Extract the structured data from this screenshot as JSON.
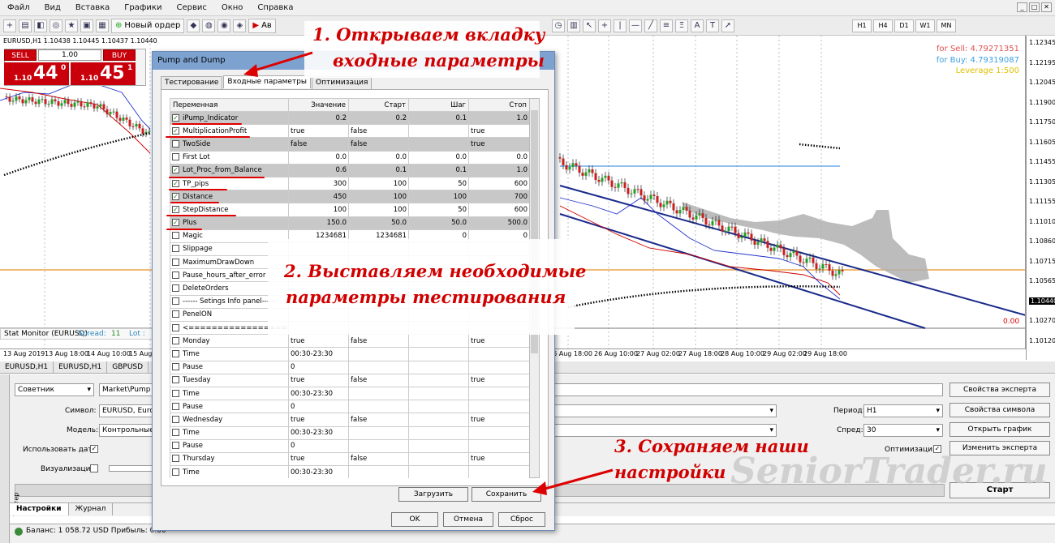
{
  "menu": [
    "Файл",
    "Вид",
    "Вставка",
    "Графики",
    "Сервис",
    "Окно",
    "Справка"
  ],
  "toolbar": {
    "new_order": "Новый ордер",
    "autotrade": "Ав",
    "timeframes": [
      "H1",
      "H4",
      "D1",
      "W1",
      "MN"
    ]
  },
  "chart": {
    "symbol_label": "EURUSD,H1  1.10438 1.10445 1.10437 1.10440",
    "sell_label": "SELL",
    "buy_label": "BUY",
    "lot": "1.00",
    "sell_small": "1.10",
    "sell_big": "44",
    "sell_sup": "0",
    "buy_small": "1.10",
    "buy_big": "45",
    "buy_sup": "1",
    "for_sell": "for Sell: 4.79271351",
    "for_buy": "for Buy: 4.79319087",
    "leverage": "Leverage 1:500",
    "price_axis": [
      "1.12345",
      "1.12195",
      "1.12045",
      "1.11900",
      "1.11750",
      "1.11605",
      "1.11455",
      "1.11305",
      "1.11155",
      "1.11010",
      "1.10860",
      "1.10715",
      "1.10565",
      "1.10440",
      "1.10270",
      "1.10120"
    ],
    "current_price": "1.10440",
    "zero_value": "0.00",
    "stat_monitor": "Stat Monitor (EURUSD)",
    "spread_label": "Spread:",
    "spread_value": "11",
    "lot_label": "Lot :",
    "time_axis": [
      "13 Aug 2019",
      "13 Aug 18:00",
      "14 Aug 10:00",
      "15 Aug",
      "26 Aug 18:00",
      "26 Aug 10:00",
      "27 Aug 02:00",
      "27 Aug 18:00",
      "28 Aug 10:00",
      "29 Aug 02:00",
      "29 Aug 18:00"
    ],
    "colors": {
      "line_blue": "#1f3aa0",
      "ichimoku_gray": "#a8a8a8",
      "candle_green": "#22a022",
      "candle_red": "#c82020",
      "accent_red": "#c9000b"
    }
  },
  "chart_tabs": [
    "EURUSD,H1",
    "EURUSD,H1",
    "GBPUSD"
  ],
  "tester": {
    "type": "Советник",
    "expert_path": "Market\\Pump and Dump",
    "symbol_label": "Символ:",
    "symbol_value": "EURUSD, Euro",
    "model_label": "Модель:",
    "model_value": "Контрольные т",
    "use_date_label": "Использовать дату",
    "visual_label": "Визуализация",
    "period_label": "Период:",
    "period_value": "H1",
    "spread_label": "Спред:",
    "spread_value": "30",
    "optimization_label": "Оптимизация",
    "btn_expert_props": "Свойства эксперта",
    "btn_symbol_props": "Свойства символа",
    "btn_open_chart": "Открыть график",
    "btn_change_expert": "Изменить эксперта",
    "btn_start": "Старт"
  },
  "bottom_tabs": [
    "Настройки",
    "Журнал"
  ],
  "side_label": "Тестер",
  "status": "Баланс: 1 058.72 USD  Прибыль: 0.00",
  "dialog": {
    "title": "Pump and Dump",
    "tabs": [
      "Тестирование",
      "Входные параметры",
      "Оптимизация"
    ],
    "headers": [
      "Переменная",
      "Значение",
      "Старт",
      "Шаг",
      "Стоп"
    ],
    "rows": [
      {
        "c": true,
        "n": "iPump_Indicator",
        "v": "0.2",
        "s": "0.2",
        "st": "0.1",
        "e": "1.0",
        "sel": true
      },
      {
        "c": true,
        "n": "MultiplicationProfit",
        "v": "true",
        "s": "false",
        "st": "",
        "e": "true",
        "sel": false
      },
      {
        "c": false,
        "n": "TwoSide",
        "v": "false",
        "s": "false",
        "st": "",
        "e": "true",
        "sel": true
      },
      {
        "c": false,
        "n": "First Lot",
        "v": "0.0",
        "s": "0.0",
        "st": "0.0",
        "e": "0.0",
        "sel": false
      },
      {
        "c": true,
        "n": "Lot_Proc_from_Balance",
        "v": "0.6",
        "s": "0.1",
        "st": "0.1",
        "e": "1.0",
        "sel": true
      },
      {
        "c": true,
        "n": "TP_pips",
        "v": "300",
        "s": "100",
        "st": "50",
        "e": "600",
        "sel": false
      },
      {
        "c": true,
        "n": "Distance",
        "v": "450",
        "s": "100",
        "st": "100",
        "e": "700",
        "sel": true
      },
      {
        "c": true,
        "n": "StepDistance",
        "v": "100",
        "s": "100",
        "st": "50",
        "e": "600",
        "sel": false
      },
      {
        "c": true,
        "n": "Plus",
        "v": "150.0",
        "s": "50.0",
        "st": "50.0",
        "e": "500.0",
        "sel": true
      },
      {
        "c": false,
        "n": "Magic",
        "v": "1234681",
        "s": "1234681",
        "st": "0",
        "e": "0",
        "sel": false
      },
      {
        "c": false,
        "n": "Slippage",
        "v": "",
        "s": "",
        "st": "",
        "e": "",
        "sel": false
      },
      {
        "c": false,
        "n": "MaximumDrawDown",
        "v": "",
        "s": "",
        "st": "",
        "e": "",
        "sel": false
      },
      {
        "c": false,
        "n": "Pause_hours_after_error",
        "v": "",
        "s": "",
        "st": "",
        "e": "",
        "sel": false
      },
      {
        "c": false,
        "n": "DeleteOrders",
        "v": "",
        "s": "",
        "st": "",
        "e": "",
        "sel": false
      },
      {
        "c": false,
        "n": "------ Setings Info panel------",
        "v": "",
        "s": "",
        "st": "",
        "e": "",
        "sel": false
      },
      {
        "c": false,
        "n": "PenelON",
        "v": "",
        "s": "",
        "st": "",
        "e": "",
        "sel": false
      },
      {
        "c": false,
        "n": "<==========================",
        "v": "",
        "s": "",
        "st": "",
        "e": "",
        "sel": false
      },
      {
        "c": false,
        "n": "Monday",
        "v": "true",
        "s": "false",
        "st": "",
        "e": "true",
        "sel": false
      },
      {
        "c": false,
        "n": "Time",
        "v": "00:30-23:30",
        "s": "",
        "st": "",
        "e": "",
        "sel": false
      },
      {
        "c": false,
        "n": "Pause",
        "v": "0",
        "s": "",
        "st": "",
        "e": "",
        "sel": false
      },
      {
        "c": false,
        "n": "Tuesday",
        "v": "true",
        "s": "false",
        "st": "",
        "e": "true",
        "sel": false
      },
      {
        "c": false,
        "n": "Time",
        "v": "00:30-23:30",
        "s": "",
        "st": "",
        "e": "",
        "sel": false
      },
      {
        "c": false,
        "n": "Pause",
        "v": "0",
        "s": "",
        "st": "",
        "e": "",
        "sel": false
      },
      {
        "c": false,
        "n": "Wednesday",
        "v": "true",
        "s": "false",
        "st": "",
        "e": "true",
        "sel": false
      },
      {
        "c": false,
        "n": "Time",
        "v": "00:30-23:30",
        "s": "",
        "st": "",
        "e": "",
        "sel": false
      },
      {
        "c": false,
        "n": "Pause",
        "v": "0",
        "s": "",
        "st": "",
        "e": "",
        "sel": false
      },
      {
        "c": false,
        "n": "Thursday",
        "v": "true",
        "s": "false",
        "st": "",
        "e": "true",
        "sel": false
      },
      {
        "c": false,
        "n": "Time",
        "v": "00:30-23:30",
        "s": "",
        "st": "",
        "e": "",
        "sel": false
      }
    ],
    "btn_load": "Загрузить",
    "btn_save": "Сохранить",
    "btn_ok": "OK",
    "btn_cancel": "Отмена",
    "btn_reset": "Сброс"
  },
  "annotations": {
    "step1_line1": "1. Открываем вкладку",
    "step1_line2": "входные параметры",
    "step2_line1": "2. Выставляем необходимые",
    "step2_line2": "параметры тестирования",
    "step3_line1": "3. Сохраняем наши",
    "step3_line2": "настройки",
    "watermark": "SeniorTrader.ru"
  }
}
